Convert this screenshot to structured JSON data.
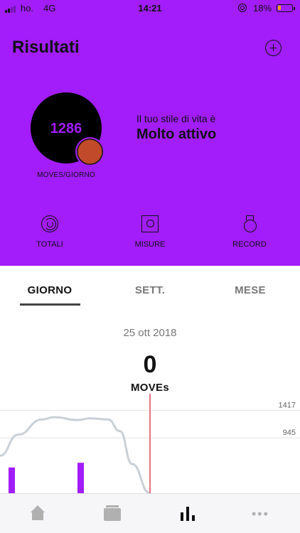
{
  "status_bar": {
    "carrier": "ho.",
    "network": "4G",
    "time": "14:21",
    "battery": "18%"
  },
  "header": {
    "title": "Risultati"
  },
  "summary": {
    "moves_value": "1286",
    "moves_unit": "MOVES/GIORNO",
    "lifestyle_label": "Il tuo stile di vita è",
    "lifestyle_value": "Molto attivo"
  },
  "quick_actions": {
    "totali": "TOTALI",
    "misure": "MISURE",
    "record": "RECORD"
  },
  "tabs": {
    "giorno": "GIORNO",
    "sett": "SETT.",
    "mese": "MESE",
    "active": "giorno"
  },
  "day": {
    "date": "25 ott 2018",
    "value": "0",
    "unit": "MOVEs"
  },
  "chart_data": {
    "type": "bar",
    "y_tick_labels": [
      "1417",
      "945"
    ],
    "y_ticks": [
      1417,
      945
    ],
    "bars": [
      {
        "value": 440
      },
      {
        "value": 520
      }
    ],
    "curve": [
      {
        "t": 0.0,
        "value": 640
      },
      {
        "t": 0.06,
        "value": 1000
      },
      {
        "t": 0.14,
        "value": 1260
      },
      {
        "t": 0.18,
        "value": 1300
      },
      {
        "t": 0.26,
        "value": 1250
      },
      {
        "t": 0.3,
        "value": 1280
      },
      {
        "t": 0.36,
        "value": 1260
      },
      {
        "t": 0.4,
        "value": 1060
      },
      {
        "t": 0.44,
        "value": 500
      },
      {
        "t": 0.5,
        "value": 0
      }
    ],
    "ylim": [
      0,
      1700
    ],
    "grid": true,
    "colors": {
      "bar": "#a21dfa",
      "curve": "#c9d0d6",
      "now_line": "#e0455a",
      "grid": "#e2e2e2"
    }
  },
  "colors": {
    "accent": "#a21dfa",
    "text": "#111111"
  },
  "bottom_nav": {
    "items": [
      "home-icon",
      "tasks-icon",
      "results-icon",
      "more-icon"
    ],
    "active": "results"
  }
}
